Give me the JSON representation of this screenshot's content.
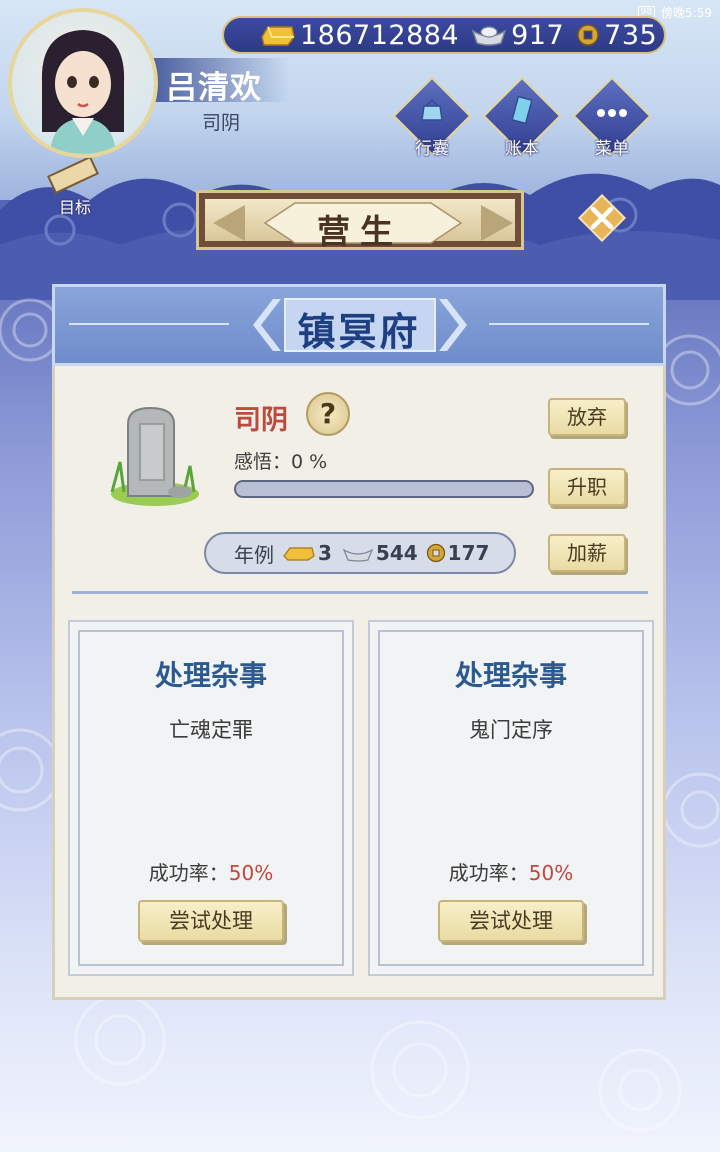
{
  "status_bar": {
    "battery": "98",
    "time": "傍晚5:59"
  },
  "currency": {
    "gold": "186712884",
    "silver": "917",
    "coins": "735"
  },
  "player": {
    "name": "吕清欢",
    "title": "司阴"
  },
  "menu": {
    "bag": "行囊",
    "ledger": "账本",
    "menu": "菜单"
  },
  "goal_label": "目标",
  "banner_title": "营生",
  "panel": {
    "header": "镇冥府",
    "office_title": "司阴",
    "insight_label": "感悟：",
    "insight_value": "0 %",
    "insight_progress": 0,
    "buttons": {
      "abandon": "放弃",
      "promote": "升职",
      "raise": "加薪"
    },
    "salary": {
      "label": "年例",
      "gold": "3",
      "silver": "544",
      "coins": "177"
    }
  },
  "tasks": [
    {
      "title": "处理杂事",
      "desc": "亡魂定罪",
      "rate_label": "成功率：",
      "rate": "50%",
      "button": "尝试处理"
    },
    {
      "title": "处理杂事",
      "desc": "鬼门定序",
      "rate_label": "成功率：",
      "rate": "50%",
      "button": "尝试处理"
    }
  ],
  "colors": {
    "accent_red": "#c2473c",
    "title_blue": "#2b5a8f",
    "header_blue": "#1e3f82"
  }
}
